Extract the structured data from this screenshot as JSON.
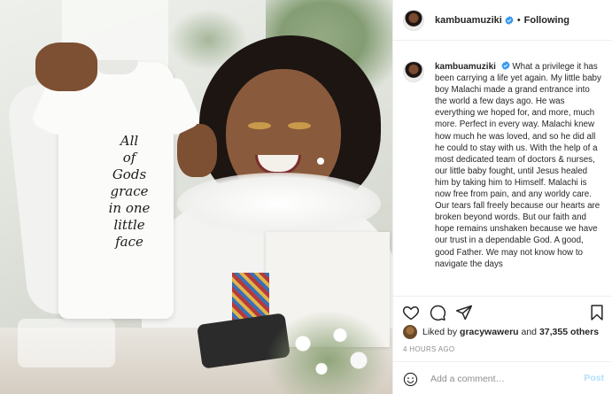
{
  "post": {
    "image_print_text": "All\nof\nGods grace\nin one\nlittle\nface"
  },
  "header": {
    "username": "kambuamuziki",
    "separator": "•",
    "follow_label": "Following"
  },
  "caption": {
    "username": "kambuamuziki",
    "text": "What a privilege it has been carrying a life yet again. My little baby boy Malachi made a grand entrance into the world a few days ago. He was everything we hoped for, and more, much more. Perfect in every way. Malachi knew how much he was loved, and so he did all he could to stay with us. With the help of a most dedicated team of doctors & nurses, our little baby fought, until Jesus healed him by taking him to Himself. Malachi is now free from pain, and any worldy care. Our tears fall freely because our hearts are broken beyond words. But our faith and hope remains unshaken because we have our trust in a dependable God. A good, good Father. We may not know how to navigate the days"
  },
  "likes": {
    "prefix": "Liked by ",
    "user": "gracywaweru",
    "middle": " and ",
    "count": "37,355 others"
  },
  "timestamp": "4 HOURS AGO",
  "comment": {
    "placeholder": "Add a comment…",
    "post_label": "Post"
  },
  "icons": {
    "verified": "verified-badge-icon",
    "like": "heart-icon",
    "comment": "comment-bubble-icon",
    "share": "paper-plane-icon",
    "save": "bookmark-icon",
    "emoji": "smiley-icon"
  },
  "colors": {
    "verified": "#3897f0",
    "post_disabled": "#b2dffc",
    "muted": "#8e8e8e",
    "text": "#262626"
  }
}
